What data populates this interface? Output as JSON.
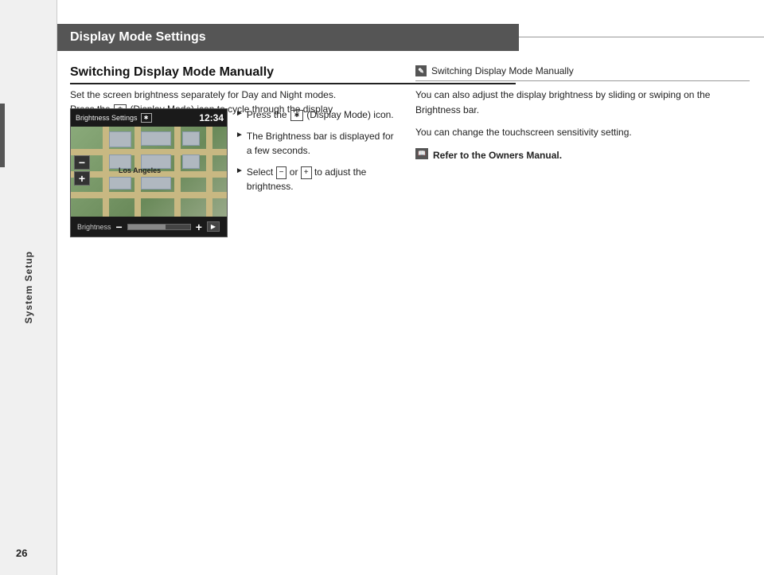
{
  "page": {
    "number": "26",
    "sidebar_label": "System Setup"
  },
  "header": {
    "title": "Display Mode Settings"
  },
  "section": {
    "title": "Switching Display Mode Manually",
    "body_text": "Set the screen brightness separately for Day and Night modes. Press the (Display Mode) icon to cycle through the display modes (Day to Night to Off).",
    "screenshot": {
      "top_label": "Brightness Settings",
      "time": "12:34",
      "brightness_label": "Brightness",
      "bar_fill_percent": 60
    },
    "steps": [
      {
        "arrow": "►",
        "text_parts": [
          "Press the ",
          " (Display Mode) icon."
        ]
      },
      {
        "arrow": "►",
        "text": "The Brightness bar is displayed for a few seconds."
      },
      {
        "arrow": "►",
        "text_parts": [
          "Select ",
          " or ",
          " to adjust the brightness."
        ]
      }
    ]
  },
  "note": {
    "header_title": "Switching Display Mode Manually",
    "body1": "You can also adjust the display brightness by sliding or swiping on the Brightness bar.",
    "body2": "You can change the touchscreen sensitivity setting.",
    "refer_text": "Refer to the Owners Manual."
  }
}
